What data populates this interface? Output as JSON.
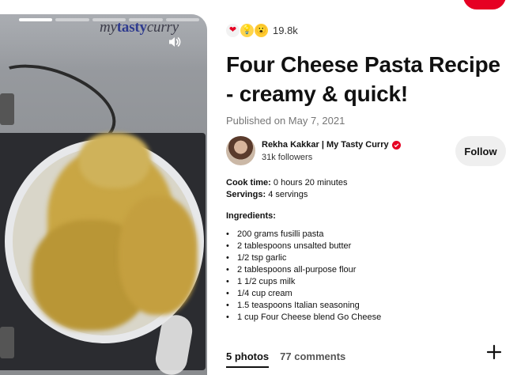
{
  "media": {
    "watermark": {
      "part1": "my",
      "part2": "tasty",
      "part3": "curry"
    },
    "progress_segments": 5,
    "progress_active_index": 0,
    "sound_icon": "speaker-icon"
  },
  "reactions": {
    "emojis": [
      "❤",
      "💡",
      "😮"
    ],
    "count": "19.8k"
  },
  "title": "Four Cheese Pasta Recipe - creamy & quick!",
  "published": "Published on May 7, 2021",
  "author": {
    "name": "Rekha Kakkar | My Tasty Curry",
    "followers": "31k followers",
    "follow_label": "Follow"
  },
  "recipe": {
    "cook_time_label": "Cook time:",
    "cook_time_value": " 0 hours 20 minutes",
    "servings_label": "Servings:",
    "servings_value": " 4 servings",
    "ingredients_title": "Ingredients:",
    "ingredients": [
      "200 grams fusilli pasta",
      "2 tablespoons unsalted butter",
      "1/2 tsp garlic",
      "2 tablespoons all-purpose flour",
      "1 1/2 cups milk",
      "1/4 cup cream",
      "1.5 teaspoons Italian seasoning",
      "1 cup Four Cheese blend Go Cheese"
    ]
  },
  "tabs": [
    {
      "label": "5 photos",
      "active": true
    },
    {
      "label": "77 comments",
      "active": false
    }
  ],
  "colors": {
    "brand": "#e60023",
    "text": "#111111",
    "muted": "#767676"
  }
}
